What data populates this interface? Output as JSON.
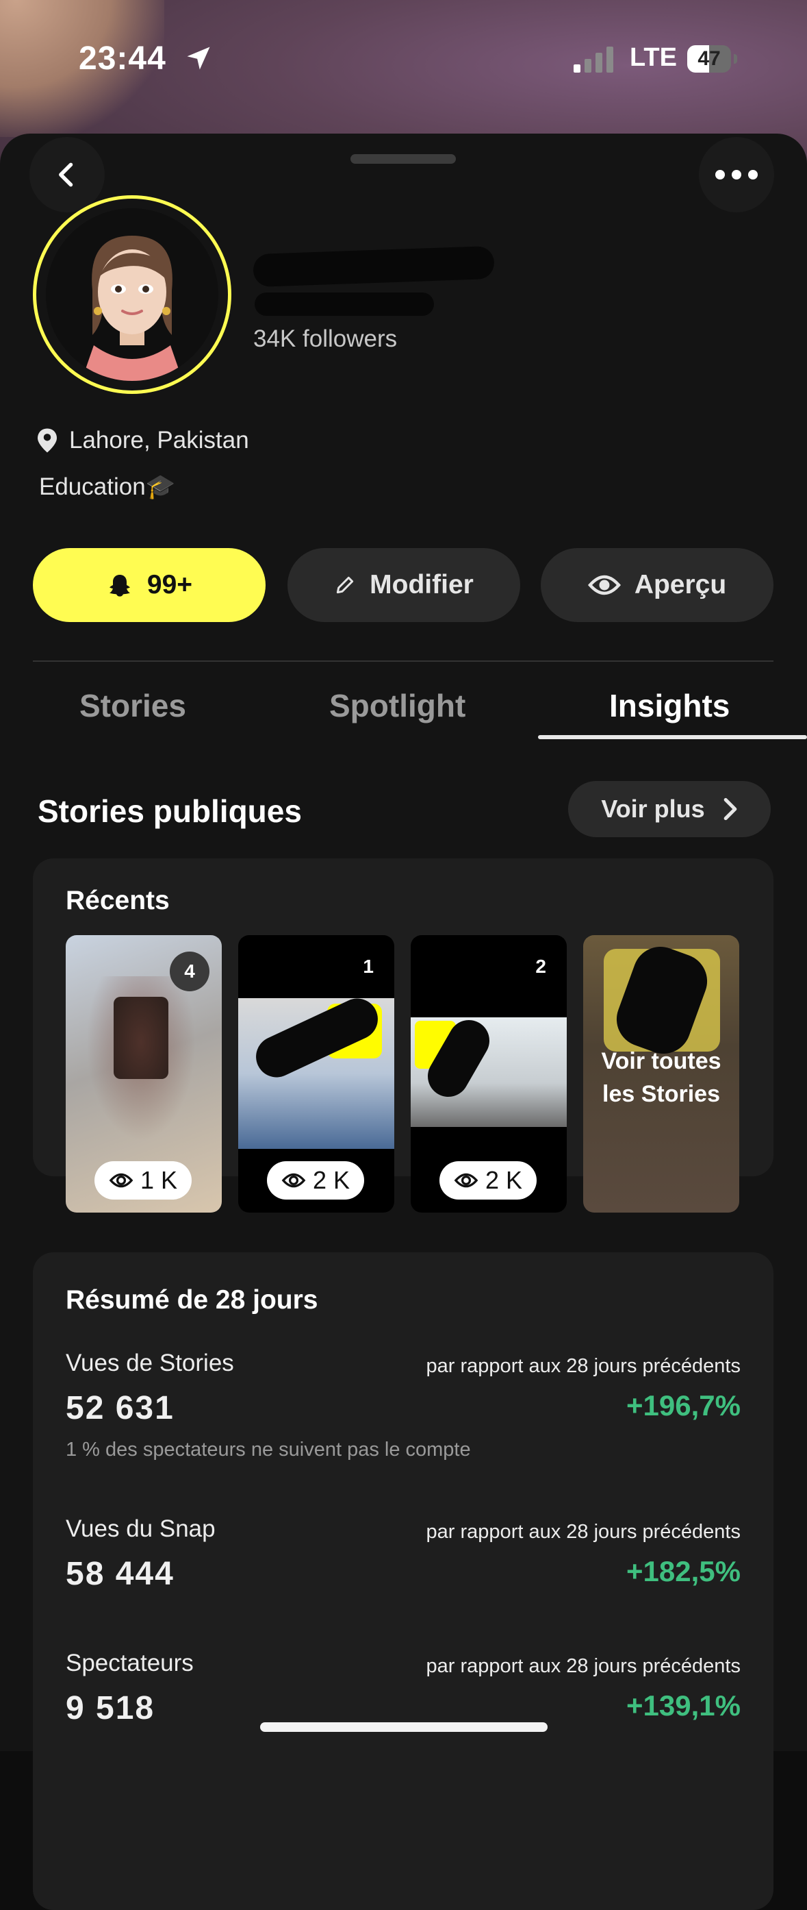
{
  "status_bar": {
    "time": "23:44",
    "network": "LTE",
    "battery": "47"
  },
  "profile": {
    "followers": "34K followers",
    "location": "Lahore, Pakistan",
    "category": "Education",
    "category_emoji": "🎓"
  },
  "actions": {
    "notif_count": "99+",
    "edit": "Modifier",
    "preview": "Aperçu"
  },
  "tabs": [
    {
      "label": "Stories"
    },
    {
      "label": "Spotlight"
    },
    {
      "label": "Insights"
    }
  ],
  "active_tab": "Insights",
  "public_stories": {
    "title": "Stories publiques",
    "see_more": "Voir plus",
    "recent_label": "Récents",
    "thumbnails": [
      {
        "badge": "4",
        "views": "1 K"
      },
      {
        "badge": "1",
        "views": "2 K"
      },
      {
        "badge": "2",
        "views": "2 K"
      },
      {
        "overlay_text": "Voir toutes les Stories"
      }
    ]
  },
  "summary": {
    "title": "Résumé de 28 jours",
    "compare_text": "par rapport aux 28 jours précédents",
    "metrics": [
      {
        "label": "Vues de Stories",
        "value": "52 631",
        "change": "+196,7%",
        "note": "1 % des spectateurs ne suivent pas le compte"
      },
      {
        "label": "Vues du Snap",
        "value": "58 444",
        "change": "+182,5%"
      },
      {
        "label": "Spectateurs",
        "value": "9 518",
        "change": "+139,1%"
      }
    ]
  },
  "colors": {
    "accent_yellow": "#fffc52",
    "positive_green": "#3fbf7f",
    "background": "#141414",
    "card": "#1e1e1e"
  }
}
